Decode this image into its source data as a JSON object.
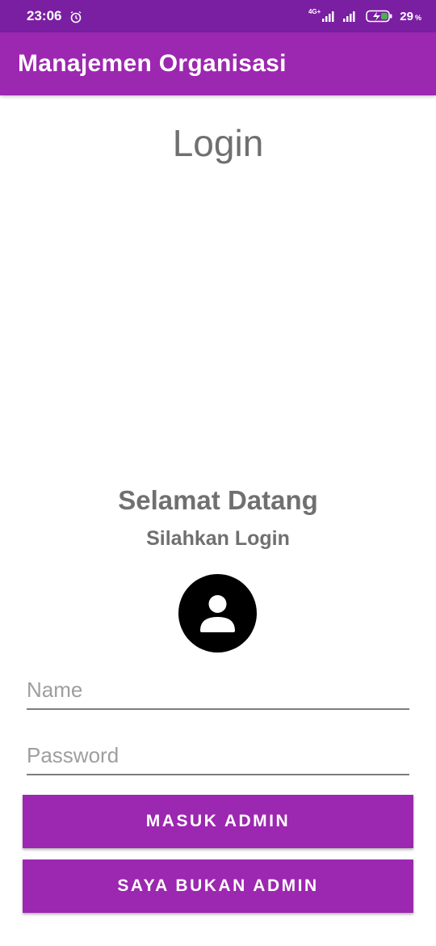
{
  "status_bar": {
    "time": "23:06",
    "network_label": "4G+",
    "battery_percent": "29",
    "battery_unit": "%",
    "icons": [
      "alarm-icon",
      "signal-icon",
      "signal-icon",
      "battery-charging-icon"
    ]
  },
  "app_bar": {
    "title": "Manajemen Organisasi"
  },
  "main": {
    "heading": "Login",
    "welcome_title": "Selamat Datang",
    "welcome_subtitle": "Silahkan Login",
    "avatar_icon": "user-icon",
    "name_field": {
      "placeholder": "Name",
      "value": ""
    },
    "password_field": {
      "placeholder": "Password",
      "value": ""
    },
    "admin_button": "MASUK ADMIN",
    "non_admin_button": "SAYA BUKAN ADMIN"
  },
  "colors": {
    "primary": "#9c27b0",
    "primary_dark": "#7a1fa2",
    "text_gray": "#707070",
    "battery_green": "#4caf50"
  }
}
